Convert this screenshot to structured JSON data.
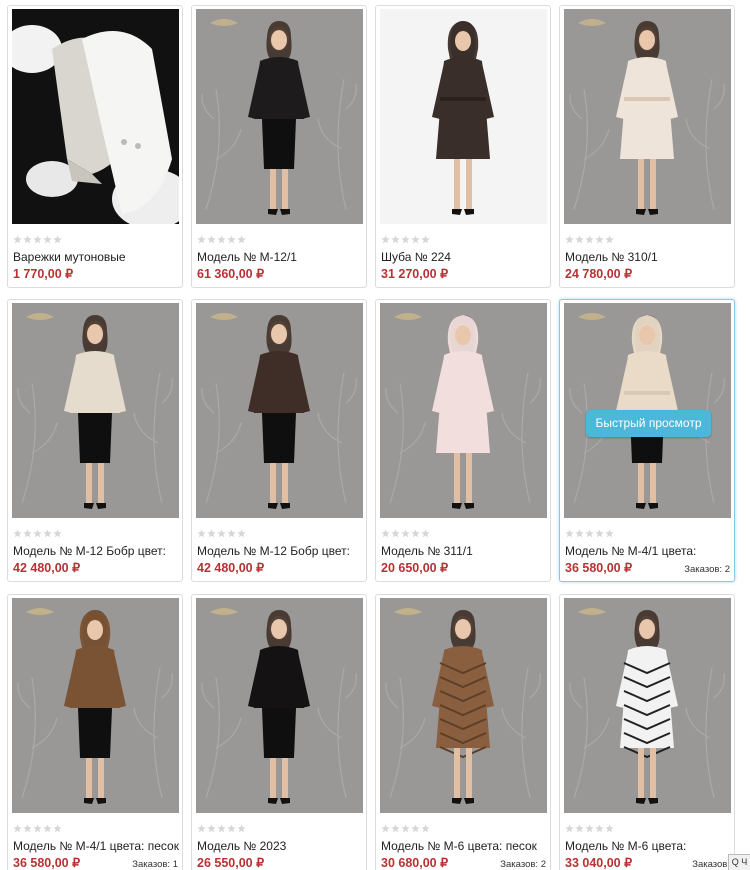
{
  "products": [
    {
      "name": "Варежки мутоновые",
      "price": "1 770,00 ₽",
      "orders": "",
      "photo": "mittens"
    },
    {
      "name": "Модель № М-12/1",
      "price": "61 360,00 ₽",
      "orders": "",
      "photo": "black-jacket"
    },
    {
      "name": "Шуба № 224",
      "price": "31 270,00 ₽",
      "orders": "",
      "photo": "brown-long-hood"
    },
    {
      "name": "Модель № 310/1",
      "price": "24 780,00 ₽",
      "orders": "",
      "photo": "cream-belt-coat"
    },
    {
      "name": "Модель № М-12 Бобр цвет:",
      "price": "42 480,00 ₽",
      "orders": "",
      "photo": "beige-cape"
    },
    {
      "name": "Модель № М-12 Бобр цвет:",
      "price": "42 480,00 ₽",
      "orders": "",
      "photo": "brown-cape"
    },
    {
      "name": "Модель № 311/1",
      "price": "20 650,00 ₽",
      "orders": "",
      "photo": "pink-hood-coat"
    },
    {
      "name": "Модель № М-4/1 цвета:",
      "price": "36 580,00 ₽",
      "orders": "Заказов: 2",
      "photo": "cream-hood-belt"
    },
    {
      "name": "Модель № М-4/1 цвета: песок",
      "price": "36 580,00 ₽",
      "orders": "Заказов: 1",
      "photo": "brown-hood-jacket"
    },
    {
      "name": "Модель № 2023",
      "price": "26 550,00 ₽",
      "orders": "",
      "photo": "black-fox-vest"
    },
    {
      "name": "Модель № М-6 цвета: песок",
      "price": "30 680,00 ₽",
      "orders": "Заказов: 2",
      "photo": "brown-chevron"
    },
    {
      "name": "Модель № М-6 цвета:",
      "price": "33 040,00 ₽",
      "orders": "Заказов:",
      "photo": "white-chevron"
    }
  ],
  "quick_view_label": "Быстрый просмотр",
  "chat_label": "Q Ч",
  "colors": {
    "price": "#b83232",
    "quick_view": "#4cb7d9",
    "active_border": "#8cc6e8"
  }
}
